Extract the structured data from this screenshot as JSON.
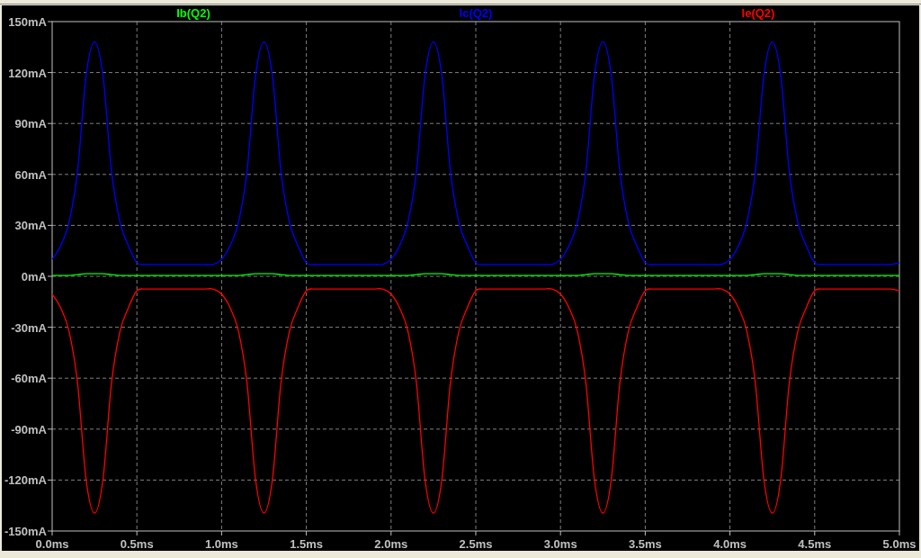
{
  "plot": {
    "chart_data": {
      "type": "line",
      "grid": true,
      "x": [
        0,
        0.05,
        0.1,
        0.15,
        0.2,
        0.25,
        0.3,
        0.35,
        0.4,
        0.45,
        0.5,
        0.55,
        0.6,
        0.65,
        0.7,
        0.75,
        0.8,
        0.85,
        0.9,
        0.95,
        1,
        1.05,
        1.1,
        1.15,
        1.2,
        1.25,
        1.3,
        1.35,
        1.4,
        1.45,
        1.5,
        1.55,
        1.6,
        1.65,
        1.7,
        1.75,
        1.8,
        1.85,
        1.9,
        1.95,
        2,
        2.05,
        2.1,
        2.15,
        2.2,
        2.25,
        2.3,
        2.35,
        2.4,
        2.45,
        2.5,
        2.55,
        2.6,
        2.65,
        2.7,
        2.75,
        2.8,
        2.85,
        2.9,
        2.95,
        3,
        3.05,
        3.1,
        3.15,
        3.2,
        3.25,
        3.3,
        3.35,
        3.4,
        3.45,
        3.5,
        3.55,
        3.6,
        3.65,
        3.7,
        3.75,
        3.8,
        3.85,
        3.9,
        3.95,
        4,
        4.05,
        4.1,
        4.15,
        4.2,
        4.25,
        4.3,
        4.35,
        4.4,
        4.45,
        4.5,
        4.55,
        4.6,
        4.65,
        4.7,
        4.75,
        4.8,
        4.85,
        4.9,
        4.95,
        5
      ],
      "series": [
        {
          "name": "Ib(Q2)",
          "color": "#00ff00",
          "values": [
            0.5,
            0.5,
            0.5,
            1,
            1.5,
            1.5,
            1.5,
            1,
            0.5,
            0.5,
            0.5,
            0.5,
            0.5,
            0.5,
            0.5,
            0.5,
            0.5,
            0.5,
            0.5,
            0.5,
            0.5,
            0.5,
            0.5,
            1,
            1.5,
            1.5,
            1.5,
            1,
            0.5,
            0.5,
            0.5,
            0.5,
            0.5,
            0.5,
            0.5,
            0.5,
            0.5,
            0.5,
            0.5,
            0.5,
            0.5,
            0.5,
            0.5,
            1,
            1.5,
            1.5,
            1.5,
            1,
            0.5,
            0.5,
            0.5,
            0.5,
            0.5,
            0.5,
            0.5,
            0.5,
            0.5,
            0.5,
            0.5,
            0.5,
            0.5,
            0.5,
            0.5,
            1,
            1.5,
            1.5,
            1.5,
            1,
            0.5,
            0.5,
            0.5,
            0.5,
            0.5,
            0.5,
            0.5,
            0.5,
            0.5,
            0.5,
            0.5,
            0.5,
            0.5,
            0.5,
            0.5,
            1,
            1.5,
            1.5,
            1.5,
            1,
            0.5,
            0.5,
            0.5,
            0.5,
            0.5,
            0.5,
            0.5,
            0.5,
            0.5,
            0.5,
            0.5,
            0.5,
            0.5
          ]
        },
        {
          "name": "Ic(Q2)",
          "color": "#0000ff",
          "values": [
            10,
            18,
            32,
            62,
            118,
            138,
            118,
            62,
            32,
            18,
            8,
            7,
            7,
            7,
            7,
            7,
            7,
            7,
            7,
            7,
            10,
            18,
            32,
            62,
            118,
            138,
            118,
            62,
            32,
            18,
            8,
            7,
            7,
            7,
            7,
            7,
            7,
            7,
            7,
            7,
            10,
            18,
            32,
            62,
            118,
            138,
            118,
            62,
            32,
            18,
            8,
            7,
            7,
            7,
            7,
            7,
            7,
            7,
            7,
            7,
            10,
            18,
            32,
            62,
            118,
            138,
            118,
            62,
            32,
            18,
            8,
            7,
            7,
            7,
            7,
            7,
            7,
            7,
            7,
            7,
            10,
            18,
            32,
            62,
            118,
            138,
            118,
            62,
            32,
            18,
            8,
            7,
            7,
            7,
            7,
            7,
            7,
            7,
            7,
            7,
            8
          ]
        },
        {
          "name": "Ie(Q2)",
          "color": "#ff0000",
          "values": [
            -10.5,
            -18.5,
            -32.5,
            -63,
            -119.5,
            -139.5,
            -119.5,
            -63,
            -32.5,
            -18.5,
            -8.5,
            -7.5,
            -7.5,
            -7.5,
            -7.5,
            -7.5,
            -7.5,
            -7.5,
            -7.5,
            -7.5,
            -10.5,
            -18.5,
            -32.5,
            -63,
            -119.5,
            -139.5,
            -119.5,
            -63,
            -32.5,
            -18.5,
            -8.5,
            -7.5,
            -7.5,
            -7.5,
            -7.5,
            -7.5,
            -7.5,
            -7.5,
            -7.5,
            -7.5,
            -10.5,
            -18.5,
            -32.5,
            -63,
            -119.5,
            -139.5,
            -119.5,
            -63,
            -32.5,
            -18.5,
            -8.5,
            -7.5,
            -7.5,
            -7.5,
            -7.5,
            -7.5,
            -7.5,
            -7.5,
            -7.5,
            -7.5,
            -10.5,
            -18.5,
            -32.5,
            -63,
            -119.5,
            -139.5,
            -119.5,
            -63,
            -32.5,
            -18.5,
            -8.5,
            -7.5,
            -7.5,
            -7.5,
            -7.5,
            -7.5,
            -7.5,
            -7.5,
            -7.5,
            -7.5,
            -10.5,
            -18.5,
            -32.5,
            -63,
            -119.5,
            -139.5,
            -119.5,
            -63,
            -32.5,
            -18.5,
            -8.5,
            -7.5,
            -7.5,
            -7.5,
            -7.5,
            -7.5,
            -7.5,
            -7.5,
            -7.5,
            -7.5,
            -8.5
          ]
        }
      ],
      "xlim": [
        0,
        5
      ],
      "ylim": [
        -150,
        150
      ],
      "xticks": [
        {
          "value": 0,
          "label": "0.0ms"
        },
        {
          "value": 0.5,
          "label": "0.5ms"
        },
        {
          "value": 1,
          "label": "1.0ms"
        },
        {
          "value": 1.5,
          "label": "1.5ms"
        },
        {
          "value": 2,
          "label": "2.0ms"
        },
        {
          "value": 2.5,
          "label": "2.5ms"
        },
        {
          "value": 3,
          "label": "3.0ms"
        },
        {
          "value": 3.5,
          "label": "3.5ms"
        },
        {
          "value": 4,
          "label": "4.0ms"
        },
        {
          "value": 4.5,
          "label": "4.5ms"
        },
        {
          "value": 5,
          "label": "5.0ms"
        }
      ],
      "yticks": [
        {
          "value": 150,
          "label": "150mA"
        },
        {
          "value": 120,
          "label": "120mA"
        },
        {
          "value": 90,
          "label": "90mA"
        },
        {
          "value": 60,
          "label": "60mA"
        },
        {
          "value": 30,
          "label": "30mA"
        },
        {
          "value": 0,
          "label": "0mA"
        },
        {
          "value": -30,
          "label": "-30mA"
        },
        {
          "value": -60,
          "label": "-60mA"
        },
        {
          "value": -90,
          "label": "-90mA"
        },
        {
          "value": -120,
          "label": "-120mA"
        },
        {
          "value": -150,
          "label": "-150mA"
        }
      ]
    }
  }
}
